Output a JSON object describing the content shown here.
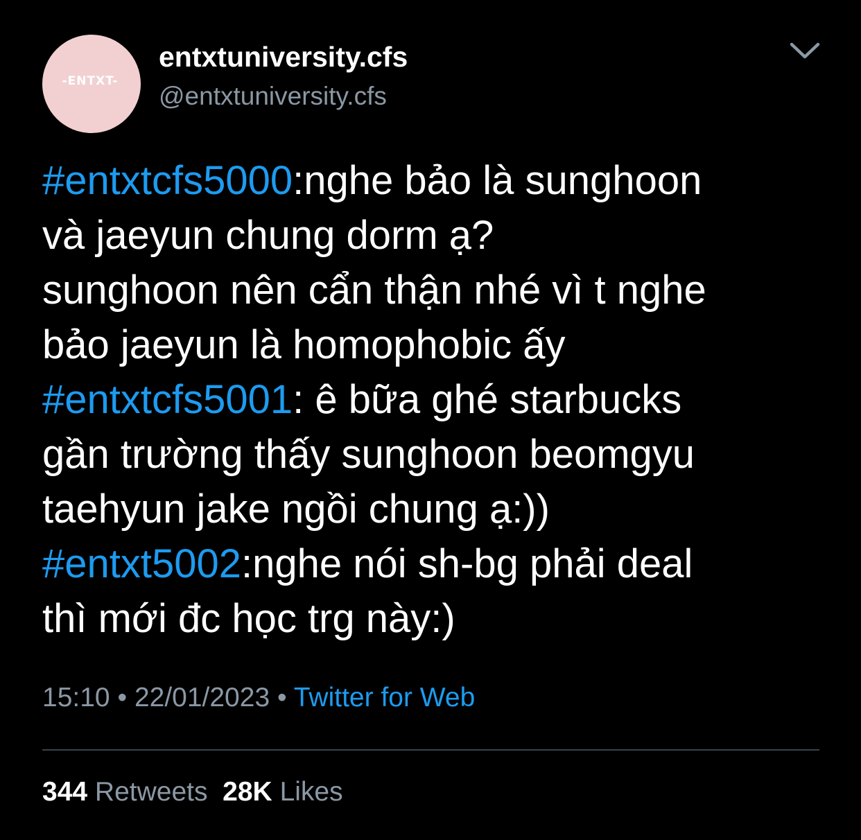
{
  "author": {
    "avatar_text": "-ENTXT-",
    "display_name": "entxtuniversity.cfs",
    "handle": "@entxtuniversity.cfs"
  },
  "icons": {
    "more_menu": "chevron-down-icon"
  },
  "tweet": {
    "lines": [
      {
        "hashtag": "#entxtcfs5000",
        "text": ":nghe bảo là sunghoon"
      },
      {
        "hashtag": "",
        "text": "và jaeyun chung dorm ạ?"
      },
      {
        "hashtag": "",
        "text": "sunghoon nên cẩn thận nhé vì t nghe"
      },
      {
        "hashtag": "",
        "text": "bảo jaeyun là homophobic ấy"
      },
      {
        "hashtag": "#entxtcfs5001",
        "text": ": ê bữa ghé starbucks"
      },
      {
        "hashtag": "",
        "text": "gần trường thấy sunghoon beomgyu"
      },
      {
        "hashtag": "",
        "text": "taehyun jake ngồi chung ạ:))"
      },
      {
        "hashtag": "#entxt5002",
        "text": ":nghe nói sh-bg phải deal"
      },
      {
        "hashtag": "",
        "text": "thì mới đc học trg này:)"
      }
    ]
  },
  "meta": {
    "time": "15:10",
    "separator": " • ",
    "date": "22/01/2023",
    "source": "Twitter for Web"
  },
  "stats": {
    "retweets_count": "344",
    "retweets_label": "Retweets",
    "likes_count": "28K",
    "likes_label": "Likes"
  },
  "colors": {
    "background": "#000000",
    "link": "#1d9bf0",
    "secondary_text": "#8b98a5",
    "avatar_bg": "#f2d0d1",
    "divider": "#38444d"
  }
}
